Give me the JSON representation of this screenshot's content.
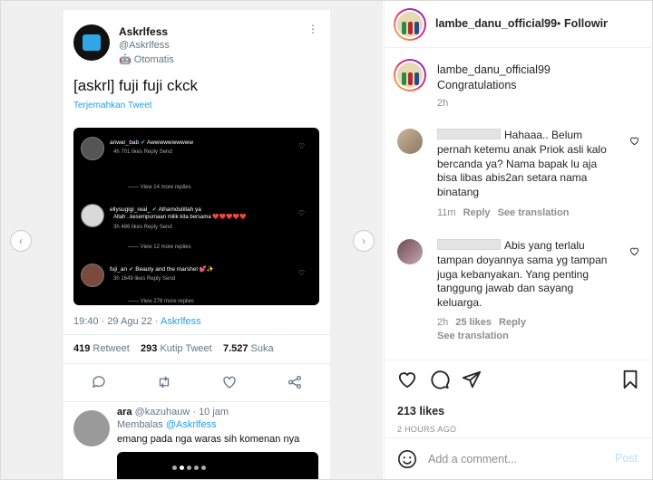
{
  "tweet": {
    "name": "Askrlfess",
    "handle": "@Askrlfess",
    "automated": "Otomatis",
    "text": "[askrl] fuji fuji ckck",
    "translate": "Terjemahkan Tweet",
    "date": "19:40 · 29 Agu 22 ·",
    "source": "Askrlfess",
    "retweets": "419",
    "retweets_label": "Retweet",
    "quotes": "293",
    "quotes_label": "Kutip Tweet",
    "likes": "7.527",
    "likes_label": "Suka",
    "reply": {
      "name": "ara",
      "handle": "@kazuhauw · 10 jam",
      "replying": "Membalas",
      "replying_to": "@Askrlfess",
      "text": "emang pada nga waras sih komenan nya"
    },
    "embedded_comments": [
      {
        "user": "anwar_bab",
        "text": "Awwwwwwwwww",
        "meta": "4h      701 likes      Reply      Send",
        "more": "View 14 more replies"
      },
      {
        "user": "ellysugigi_real_",
        "text": "Alhamdulillah ya",
        "text2": "Allah ..kesempurnaan milik kita bersama ❤️❤️❤️❤️❤️",
        "meta": "3h      486 likes      Reply      Send",
        "more": "View 12 more replies"
      },
      {
        "user": "fuji_an",
        "text": "Beauty and the marshel 💕✨",
        "meta": "3h      1649 likes      Reply      Send",
        "more": "View 278 more replies"
      }
    ]
  },
  "post": {
    "username": "lambe_danu_official99",
    "follow_label": "Following",
    "caption": "Congratulations",
    "caption_time": "2h",
    "likes": "213 likes",
    "ago": "2 HOURS AGO",
    "add_placeholder": "Add a comment...",
    "post_label": "Post"
  },
  "comments": [
    {
      "text": "Hahaaa.. Belum pernah ketemu anak Priok asli kalo bercanda ya? Nama bapak lu aja bisa libas abis2an setara nama binatang",
      "time": "11m",
      "reply": "Reply",
      "see_translation": "See translation"
    },
    {
      "text": "Abis yang terlalu tampan doyannya sama yg tampan juga kebanyakan. Yang penting tanggung jawab dan sayang keluarga.",
      "time": "2h",
      "likes": "25 likes",
      "reply": "Reply",
      "see_translation": "See translation"
    }
  ],
  "colors": {
    "link_blue": "#1da1f2",
    "verified": "#5ac8fa",
    "muted": "#8e8e8e",
    "post_disabled": "#b2dffc"
  }
}
